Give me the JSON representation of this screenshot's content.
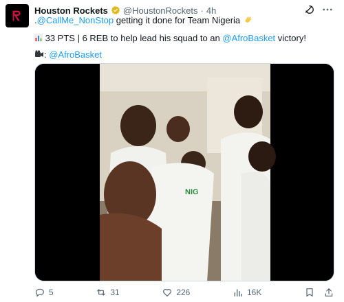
{
  "tweet": {
    "author": {
      "display_name": "Houston Rockets",
      "handle": "@HoustonRockets",
      "separator": "·",
      "time": "4h"
    },
    "line1": {
      "prefix": ".",
      "mention": "@CallMe_NonStop",
      "text": " getting it done for Team Nigeria",
      "emoji": "clapping-hands-icon"
    },
    "line2": {
      "emoji": "bar-chart-icon",
      "text": " 33 PTS | 6 REB to help lead his squad to an ",
      "hashtag": "@AfroBasket",
      "suffix": " victory!"
    },
    "line3": {
      "emoji": "video-camera-icon",
      "text": ": ",
      "mention": "@AfroBasket"
    },
    "media": {
      "type": "video",
      "description_icon": "video-thumbnail"
    },
    "actions": {
      "replies": "5",
      "reposts": "31",
      "likes": "226",
      "views": "16K"
    },
    "colors": {
      "link": "#1d9bf0",
      "secondary": "#536471",
      "verified": "#e2b719"
    }
  }
}
